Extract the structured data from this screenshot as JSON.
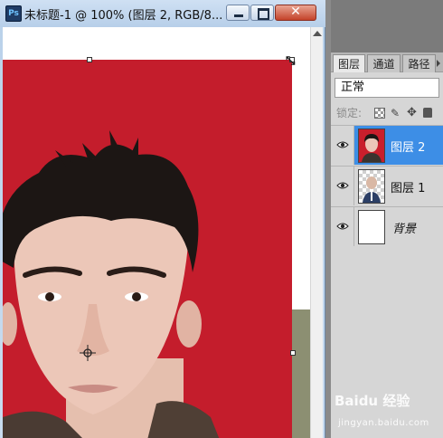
{
  "window": {
    "app_icon": "Ps",
    "title": "未标题-1 @ 100% (图层 2, RGB/8...",
    "close_glyph": "✕"
  },
  "layers_panel": {
    "tabs": [
      {
        "label": "图层",
        "active": true
      },
      {
        "label": "通道",
        "active": false
      },
      {
        "label": "路径",
        "active": false
      }
    ],
    "blend_mode": "正常",
    "lock_label": "锁定:",
    "layers": [
      {
        "name": "图层 2",
        "selected": true,
        "visible": true,
        "thumbnail": "photo"
      },
      {
        "name": "图层 1",
        "selected": false,
        "visible": true,
        "thumbnail": "transparent-with-figure"
      },
      {
        "name": "背景",
        "selected": false,
        "visible": true,
        "thumbnail": "white"
      }
    ]
  },
  "watermark": {
    "brand": "Baidu 经验",
    "site": "jingyan.baidu.com"
  },
  "colors": {
    "photo_background": "#c91f2c",
    "selected_layer": "#3d8ee6",
    "panel_bg": "#d6d6d6"
  }
}
